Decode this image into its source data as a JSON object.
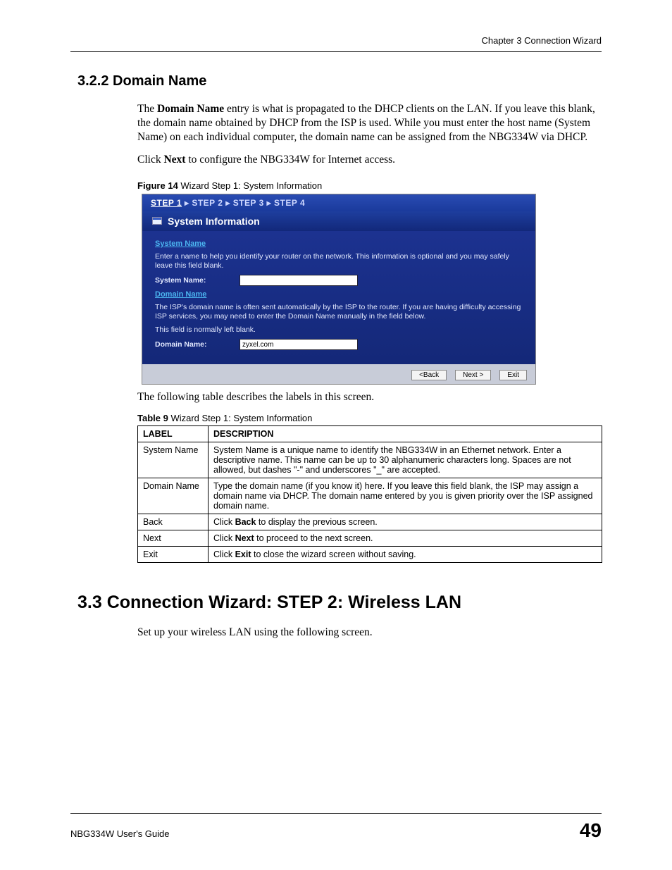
{
  "header": {
    "chapter": "Chapter 3 Connection Wizard"
  },
  "section322": {
    "heading": "3.2.2  Domain Name",
    "para1_before": "The ",
    "para1_bold": "Domain Name",
    "para1_after": " entry is what is propagated to the DHCP clients on the LAN. If you leave this blank, the domain name obtained by DHCP from the ISP is used. While you must enter the host name (System Name) on each individual computer, the domain name can be assigned from the NBG334W via DHCP.",
    "para2_before": "Click ",
    "para2_bold": "Next",
    "para2_after": " to configure the NBG334W for Internet access."
  },
  "figure": {
    "label": "Figure 14",
    "caption": "   Wizard Step 1: System Information"
  },
  "wizard": {
    "steps": {
      "s1": "STEP 1",
      "sep": " ▸ ",
      "s2": "STEP 2",
      "s3": "STEP 3",
      "s4": "STEP 4"
    },
    "title": "System Information",
    "sys_section": "System Name",
    "sys_desc": "Enter a name to help you identify your router on the network. This information is optional and you may safely leave this field blank.",
    "sys_label": "System Name:",
    "dom_section": "Domain Name",
    "dom_desc1": "The ISP's domain name is often sent automatically by the ISP to the router. If you are having difficulty accessing ISP services, you may need to enter the Domain Name manually in the field below.",
    "dom_desc2": "This field is normally left blank.",
    "dom_label": "Domain Name:",
    "dom_value": "zyxel.com",
    "btn_back": "<Back",
    "btn_next": "Next >",
    "btn_exit": "Exit"
  },
  "post_figure": "The following table describes the labels in this screen.",
  "table": {
    "label": "Table 9",
    "caption": "   Wizard Step 1: System Information",
    "head_label": "LABEL",
    "head_desc": "DESCRIPTION",
    "rows": [
      {
        "label": "System Name",
        "desc": "System Name is a unique name to identify the NBG334W in an Ethernet network. Enter a descriptive name. This name can be up to 30 alphanumeric characters long. Spaces are not allowed, but dashes \"-\" and underscores \"_\" are accepted."
      },
      {
        "label": "Domain Name",
        "desc": "Type the domain name (if you know it) here. If you leave this field blank, the ISP may assign a domain name via DHCP. The domain name entered by you is given priority over the ISP assigned domain name."
      },
      {
        "label": "Back",
        "desc_pre": "Click ",
        "desc_bold": "Back",
        "desc_post": " to display the previous screen."
      },
      {
        "label": "Next",
        "desc_pre": "Click ",
        "desc_bold": "Next",
        "desc_post": " to proceed to the next screen."
      },
      {
        "label": "Exit",
        "desc_pre": "Click ",
        "desc_bold": "Exit",
        "desc_post": " to close the wizard screen without saving."
      }
    ]
  },
  "section33": {
    "heading": "3.3  Connection Wizard: STEP 2: Wireless LAN",
    "para": "Set up your wireless LAN using the following screen."
  },
  "footer": {
    "guide": "NBG334W User's Guide",
    "page": "49"
  }
}
